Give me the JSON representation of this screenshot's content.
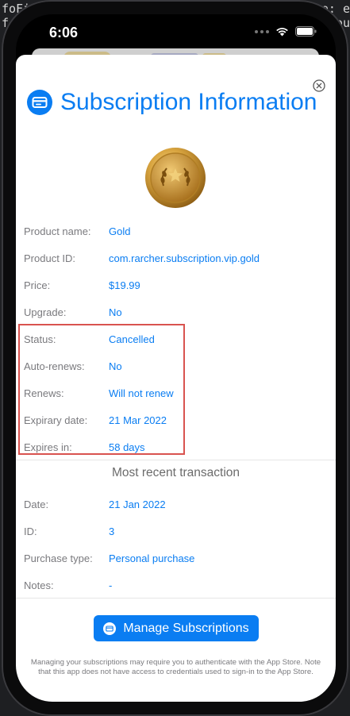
{
  "background_code": {
    "line1_left": "foFi",
    "line1_right": "ue: e",
    "line2_left": "f",
    "line2_right": "ou"
  },
  "status_bar": {
    "time": "6:06"
  },
  "sheet": {
    "title": "Subscription Information",
    "product": {
      "rows": [
        {
          "label": "Product name:",
          "value": "Gold"
        },
        {
          "label": "Product ID:",
          "value": "com.rarcher.subscription.vip.gold"
        },
        {
          "label": "Price:",
          "value": "$19.99"
        },
        {
          "label": "Upgrade:",
          "value": "No"
        },
        {
          "label": "Status:",
          "value": "Cancelled"
        },
        {
          "label": "Auto-renews:",
          "value": "No"
        },
        {
          "label": "Renews:",
          "value": "Will not renew"
        },
        {
          "label": "Expirary date:",
          "value": "21 Mar 2022"
        },
        {
          "label": "Expires in:",
          "value": "58 days"
        }
      ]
    },
    "transaction": {
      "title": "Most recent transaction",
      "rows": [
        {
          "label": "Date:",
          "value": "21 Jan 2022"
        },
        {
          "label": "ID:",
          "value": "3"
        },
        {
          "label": "Purchase type:",
          "value": "Personal purchase"
        },
        {
          "label": "Notes:",
          "value": "-"
        }
      ]
    },
    "manage_button": "Manage Subscriptions",
    "footnote": "Managing your subscriptions may require you to authenticate with the App Store. Note that this app does not have access to credentials used to sign-in to the App Store."
  },
  "colors": {
    "accent": "#0a7df2",
    "highlight": "#d9534f",
    "label": "#7a7a7e"
  },
  "icons": {
    "close": "close-circle-icon",
    "title": "credit-card-circle-icon",
    "medal": "gold-medal-icon",
    "wifi": "wifi-icon",
    "battery": "battery-icon"
  }
}
